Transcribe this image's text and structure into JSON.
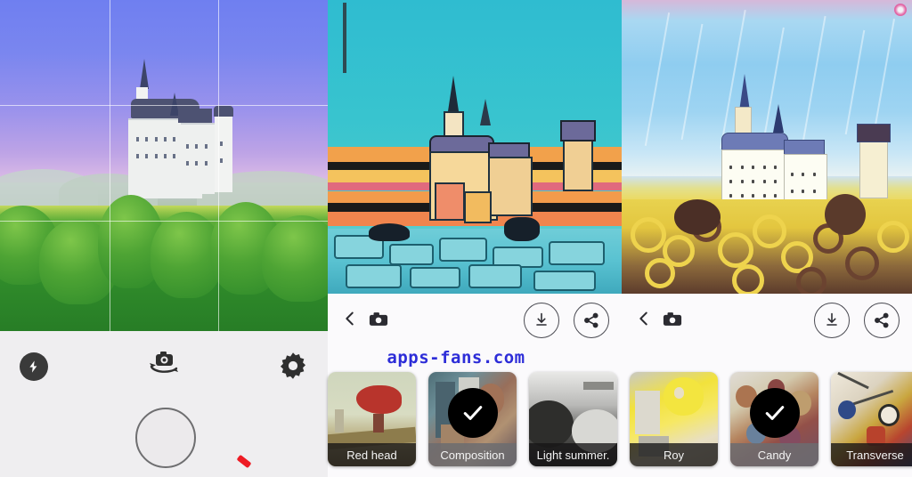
{
  "app": {
    "watermark": "apps-fans.com",
    "accent_blue": "#2d2dd8"
  },
  "camera_panel": {
    "name": "camera-viewfinder",
    "scene": "Neuschwanstein castle",
    "grid_visible": true,
    "controls": {
      "flash_icon": "flash-icon",
      "flash_label": "Flash",
      "flip_icon": "camera-flip-icon",
      "flip_label": "Switch camera",
      "settings_icon": "gear-icon",
      "settings_label": "Settings",
      "shutter_icon": "shutter-button",
      "shutter_label": "Capture"
    }
  },
  "result_panels": [
    {
      "id": "preview-cartoon",
      "style_name": "Composition",
      "toolbar": {
        "back_icon": "chevron-left-icon",
        "back_label": "Back",
        "camera_icon": "camera-icon",
        "camera_label": "Camera",
        "save_icon": "download-icon",
        "save_label": "Save",
        "share_icon": "share-icon",
        "share_label": "Share"
      }
    },
    {
      "id": "preview-vangogh",
      "style_name": "Candy",
      "toolbar": {
        "back_icon": "chevron-left-icon",
        "back_label": "Back",
        "camera_icon": "camera-icon",
        "camera_label": "Camera",
        "save_icon": "download-icon",
        "save_label": "Save",
        "share_icon": "share-icon",
        "share_label": "Share"
      }
    }
  ],
  "filter_strip": {
    "name": "style-filter-strip",
    "items": [
      {
        "label": "Red head",
        "art": "art-redhead",
        "selected": false
      },
      {
        "label": "Composition",
        "art": "art-comp",
        "selected": true
      },
      {
        "label": "Light summer.",
        "art": "art-light",
        "selected": false
      },
      {
        "label": "Roy",
        "art": "art-roy",
        "selected": false
      },
      {
        "label": "Candy",
        "art": "art-candy",
        "selected": true
      },
      {
        "label": "Transverse",
        "art": "art-trans",
        "selected": false
      }
    ],
    "check_icon": "check-icon"
  }
}
